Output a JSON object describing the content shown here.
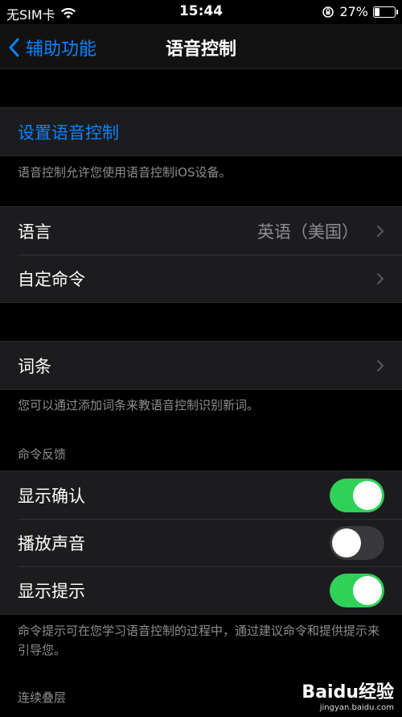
{
  "status": {
    "carrier": "无SIM卡",
    "time": "15:44",
    "battery": "27%",
    "battery_level": 0.27
  },
  "nav": {
    "back_label": "辅助功能",
    "title": "语音控制"
  },
  "setup": {
    "link": "设置语音控制",
    "footnote": "语音控制允许您使用语音控制iOS设备。"
  },
  "language": {
    "label": "语言",
    "value": "英语（美国）"
  },
  "custom_commands": {
    "label": "自定命令"
  },
  "vocabulary": {
    "label": "词条",
    "footnote": "您可以通过添加词条来教语音控制识别新词。"
  },
  "feedback": {
    "header": "命令反馈",
    "items": [
      {
        "label": "显示确认",
        "on": true
      },
      {
        "label": "播放声音",
        "on": false
      },
      {
        "label": "显示提示",
        "on": true
      }
    ],
    "footnote": "命令提示可在您学习语音控制的过程中，通过建议命令和提供提示来引导您。"
  },
  "overlay": {
    "header": "连续叠层"
  },
  "watermark": {
    "main": "Baidu经验",
    "sub": "jingyan.baidu.com"
  }
}
